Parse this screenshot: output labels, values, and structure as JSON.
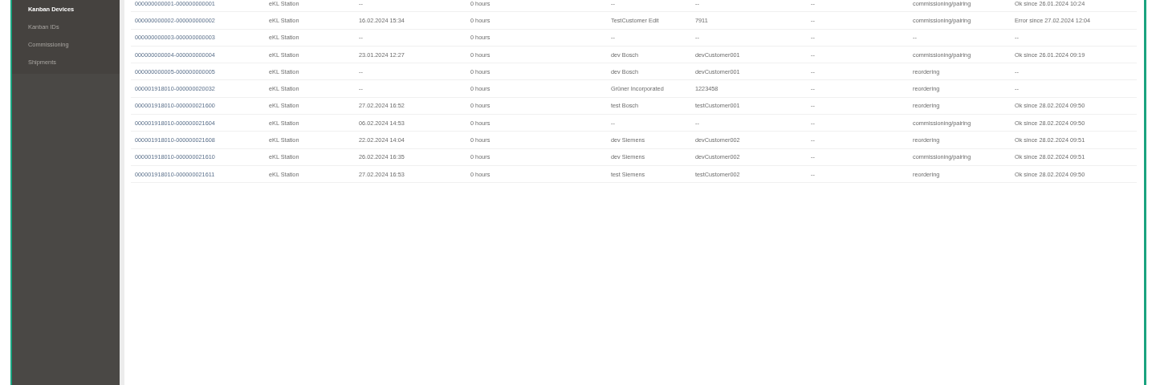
{
  "sidebar": {
    "items": [
      {
        "label": "Kanban Devices",
        "selected": true
      },
      {
        "label": "Kanban IDs",
        "selected": false
      },
      {
        "label": "Commissioning",
        "selected": false
      },
      {
        "label": "Shipments",
        "selected": false
      }
    ]
  },
  "table": {
    "rows": [
      {
        "cells": [
          "000000000001-000000000001",
          "eKL Station",
          "--",
          "0 hours",
          "--",
          "--",
          "--",
          "commissioning/pairing",
          "Ok since 26.01.2024 10:24"
        ]
      },
      {
        "cells": [
          "000000000002-000000000002",
          "eKL Station",
          "16.02.2024 15:34",
          "0 hours",
          "TestCustomer Edit",
          "7911",
          "--",
          "commissioning/pairing",
          "Error since 27.02.2024 12:04"
        ]
      },
      {
        "cells": [
          "000000000003-000000000003",
          "eKL Station",
          "--",
          "0 hours",
          "--",
          "--",
          "--",
          "--",
          "--"
        ]
      },
      {
        "cells": [
          "000000000004-000000000004",
          "eKL Station",
          "23.01.2024 12:27",
          "0 hours",
          "dev Bosch",
          "devCustomer001",
          "--",
          "commissioning/pairing",
          "Ok since 26.01.2024 09:19"
        ]
      },
      {
        "cells": [
          "000000000005-000000000005",
          "eKL Station",
          "--",
          "0 hours",
          "dev Bosch",
          "devCustomer001",
          "--",
          "reordering",
          "--"
        ]
      },
      {
        "cells": [
          "000001918010-000000020032",
          "eKL Station",
          "--",
          "0 hours",
          "Grüner Incorporated",
          "1223458",
          "--",
          "reordering",
          "--"
        ]
      },
      {
        "cells": [
          "000001918010-000000021600",
          "eKL Station",
          "27.02.2024 16:52",
          "0 hours",
          "test Bosch",
          "testCustomer001",
          "--",
          "reordering",
          "Ok since 28.02.2024 09:50"
        ]
      },
      {
        "cells": [
          "000001918010-000000021604",
          "eKL Station",
          "06.02.2024 14:53",
          "0 hours",
          "--",
          "--",
          "--",
          "commissioning/pairing",
          "Ok since 28.02.2024 09:50"
        ]
      },
      {
        "cells": [
          "000001918010-000000021608",
          "eKL Station",
          "22.02.2024 14:04",
          "0 hours",
          "dev Siemens",
          "devCustomer002",
          "--",
          "reordering",
          "Ok since 28.02.2024 09:51"
        ]
      },
      {
        "cells": [
          "000001918010-000000021610",
          "eKL Station",
          "26.02.2024 16:35",
          "0 hours",
          "dev Siemens",
          "devCustomer002",
          "--",
          "commissioning/pairing",
          "Ok since 28.02.2024 09:51"
        ]
      },
      {
        "cells": [
          "000001918010-000000021611",
          "eKL Station",
          "27.02.2024 16:53",
          "0 hours",
          "test Siemens",
          "testCustomer002",
          "--",
          "reordering",
          "Ok since 28.02.2024 09:50"
        ]
      }
    ]
  }
}
